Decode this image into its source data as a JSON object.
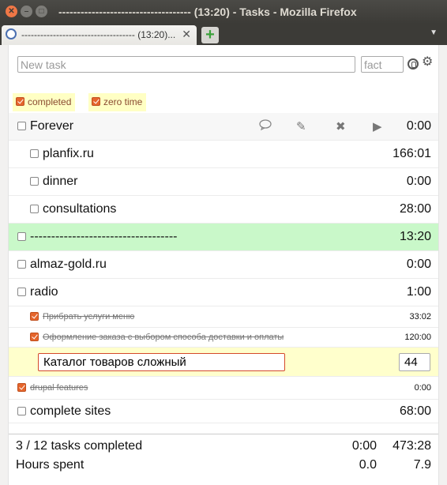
{
  "window": {
    "title": "------------------------------------ (13:20) - Tasks - Mozilla Firefox",
    "tab_title": "------------------------------------ (13:20)...",
    "new_tab_symbol": "+"
  },
  "toolbar": {
    "new_task_placeholder": "New task",
    "fact_placeholder": "fact"
  },
  "filters": [
    {
      "label": "completed",
      "checked": true
    },
    {
      "label": "zero time",
      "checked": true
    }
  ],
  "tasks": [
    {
      "name": "Forever",
      "time": "0:00",
      "checked": false,
      "level": 0
    },
    {
      "name": "planfix.ru",
      "time": "166:01",
      "checked": false,
      "level": 1
    },
    {
      "name": "dinner",
      "time": "0:00",
      "checked": false,
      "level": 1
    },
    {
      "name": "consultations",
      "time": "28:00",
      "checked": false,
      "level": 1
    },
    {
      "name": "-----------------------------------",
      "time": "13:20",
      "checked": false,
      "level": 0,
      "active": true
    },
    {
      "name": "almaz-gold.ru",
      "time": "0:00",
      "checked": false,
      "level": 0
    },
    {
      "name": "radio",
      "time": "1:00",
      "checked": false,
      "level": 0
    },
    {
      "name": "Прибрать услуги меню",
      "time": "33:02",
      "checked": true,
      "level": 1
    },
    {
      "name": "Оформление заказа с выбором способа доставки и оплаты",
      "time": "120:00",
      "checked": true,
      "level": 1
    },
    {
      "name": "Каталог товаров сложный",
      "time": "44",
      "checked": false,
      "level": 1,
      "editing": true
    },
    {
      "name": "drupal features",
      "time": "0:00",
      "checked": true,
      "level": 0
    },
    {
      "name": "complete sites",
      "time": "68:00",
      "checked": false,
      "level": 0
    }
  ],
  "summary": {
    "tasks_completed": "3 / 12 tasks completed",
    "today_time": "0:00",
    "total_time": "473:28",
    "hours_label": "Hours spent",
    "hours_today": "0.0",
    "hours_total": "7.9"
  },
  "colors": {
    "active_row": "#c9f8c9",
    "editing_row": "#ffffcc",
    "filter_bg": "#ffffc4",
    "check_accent": "#e5652c"
  },
  "icons": [
    "comment-icon",
    "pencil-icon",
    "delete-icon",
    "play-icon",
    "clock-icon",
    "gear-icon"
  ]
}
